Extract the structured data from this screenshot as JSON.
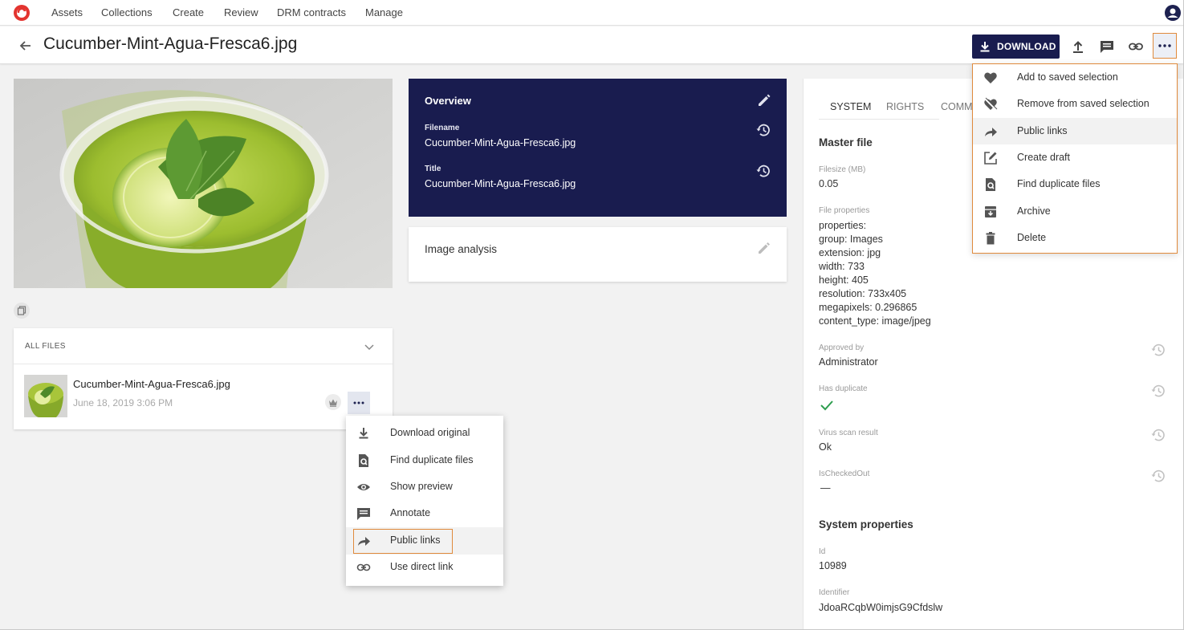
{
  "nav": {
    "items": [
      "Assets",
      "Collections",
      "Create",
      "Review",
      "DRM contracts",
      "Manage"
    ]
  },
  "header": {
    "title": "Cucumber-Mint-Agua-Fresca6.jpg",
    "download_label": "DOWNLOAD"
  },
  "top_menu": {
    "items": [
      {
        "label": "Add to saved selection",
        "icon": "heart-icon"
      },
      {
        "label": "Remove from saved selection",
        "icon": "heart-broken-icon"
      },
      {
        "label": "Public links",
        "icon": "share-arrow-icon"
      },
      {
        "label": "Create draft",
        "icon": "edit-square-icon"
      },
      {
        "label": "Find duplicate files",
        "icon": "find-file-icon"
      },
      {
        "label": "Archive",
        "icon": "archive-icon"
      },
      {
        "label": "Delete",
        "icon": "trash-icon"
      }
    ],
    "highlighted": "Public links"
  },
  "files": {
    "header": "ALL FILES",
    "file_name": "Cucumber-Mint-Agua-Fresca6.jpg",
    "file_date": "June 18, 2019 3:06 PM"
  },
  "file_menu": {
    "items": [
      {
        "label": "Download original",
        "icon": "download-icon"
      },
      {
        "label": "Find duplicate files",
        "icon": "find-file-icon"
      },
      {
        "label": "Show preview",
        "icon": "eye-icon"
      },
      {
        "label": "Annotate",
        "icon": "comment-icon"
      },
      {
        "label": "Public links",
        "icon": "share-arrow-icon"
      },
      {
        "label": "Use direct link",
        "icon": "link-icon"
      }
    ],
    "highlighted": "Public links"
  },
  "overview": {
    "title": "Overview",
    "filename_label": "Filename",
    "filename_value": "Cucumber-Mint-Agua-Fresca6.jpg",
    "title_label": "Title",
    "title_value": "Cucumber-Mint-Agua-Fresca6.jpg"
  },
  "analysis": {
    "title": "Image analysis"
  },
  "right_panel": {
    "tabs": [
      "SYSTEM",
      "RIGHTS",
      "COMM"
    ],
    "active_tab": "SYSTEM",
    "master_file": "Master file",
    "filesize_label": "Filesize (MB)",
    "filesize_value": "0.05",
    "file_properties_label": "File properties",
    "properties": [
      {
        "k": "properties:",
        "v": ""
      },
      {
        "k": "group:",
        "v": " Images"
      },
      {
        "k": "extension:",
        "v": " jpg"
      },
      {
        "k": "width:",
        "v": " 733"
      },
      {
        "k": "height:",
        "v": " 405"
      },
      {
        "k": "resolution:",
        "v": " 733x405"
      },
      {
        "k": "megapixels:",
        "v": " 0.296865"
      },
      {
        "k": "content_type:",
        "v": " image/jpeg"
      }
    ],
    "approved_by_label": "Approved by",
    "approved_by_value": "Administrator",
    "has_duplicate_label": "Has duplicate",
    "virus_label": "Virus scan result",
    "virus_value": "Ok",
    "checked_out_label": "IsCheckedOut",
    "checked_out_value": "—",
    "system_properties": "System properties",
    "id_label": "Id",
    "id_value": "10989",
    "identifier_label": "Identifier",
    "identifier_value": "JdoaRCqbW0imjsG9Cfdslw"
  },
  "colors": {
    "navy": "#191c4f",
    "accent_orange": "#e08a3c",
    "check_green": "#2e9e4f"
  }
}
